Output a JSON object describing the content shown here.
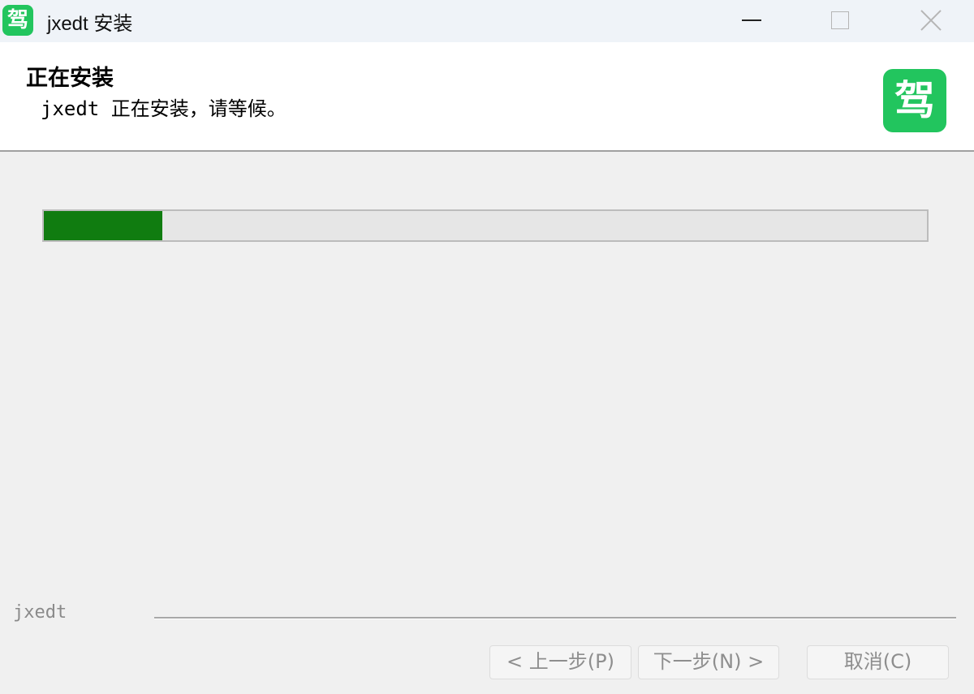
{
  "window": {
    "title": "jxedt 安装",
    "icon_glyph": "驾",
    "controls": [
      "minimize-icon",
      "maximize-icon",
      "close-icon"
    ]
  },
  "header": {
    "title": "正在安装",
    "subtitle": "jxedt 正在安装，请等候。",
    "logo_glyph": "驾"
  },
  "progress": {
    "value_percent": 13.4,
    "fill_color": "#107c10"
  },
  "footer": {
    "brand": "jxedt",
    "buttons": {
      "back": "< 上一步(P)",
      "next": "下一步(N) >",
      "cancel": "取消(C)"
    }
  },
  "colors": {
    "brand_green": "#22c55e",
    "progress_green": "#107c10",
    "disabled_text": "#8e8e8e"
  }
}
